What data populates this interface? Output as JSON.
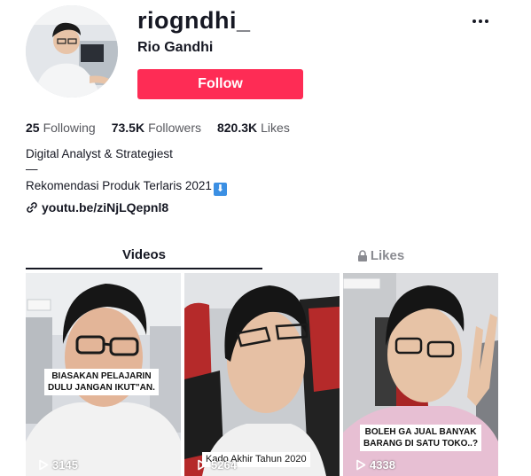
{
  "profile": {
    "username": "riogndhi_",
    "display_name": "Rio Gandhi",
    "follow_label": "Follow",
    "avatar_icon": "avatar-photo"
  },
  "stats": [
    {
      "value": "25",
      "label": "Following"
    },
    {
      "value": "73.5K",
      "label": "Followers"
    },
    {
      "value": "820.3K",
      "label": "Likes"
    }
  ],
  "bio": {
    "line1": "Digital Analyst & Strategiest",
    "line2": "—",
    "line3": "Rekomendasi Produk Terlaris 2021",
    "line3_emoji": "⬇",
    "link": "youtu.be/ziNjLQepnl8"
  },
  "tabs": {
    "videos": "Videos",
    "likes": "Likes"
  },
  "videos": [
    {
      "caption": [
        "BIASAKAN PELAJARIN",
        "DULU JANGAN IKUT\"AN."
      ],
      "views": "3145"
    },
    {
      "caption": [
        "Kado Akhir Tahun 2020"
      ],
      "views": "5264"
    },
    {
      "caption": [
        "BOLEH GA JUAL BANYAK",
        "BARANG DI SATU TOKO..?"
      ],
      "views": "4338"
    }
  ],
  "colors": {
    "accent": "#fe2c55",
    "text": "#161823",
    "muted": "#8a8b91"
  }
}
